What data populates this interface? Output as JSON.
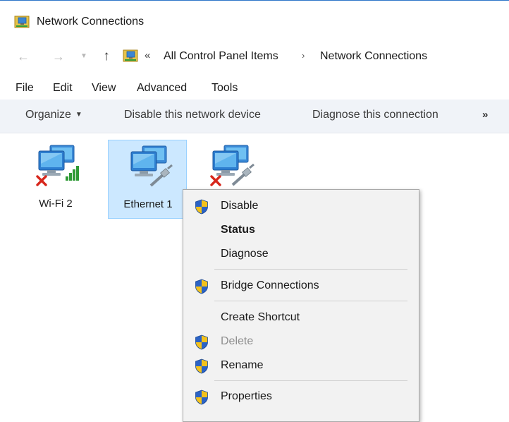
{
  "window": {
    "title": "Network Connections"
  },
  "address": {
    "overflow_chevron": "«",
    "crumbs": [
      "All Control Panel Items",
      "Network Connections"
    ],
    "separator": "›"
  },
  "menubar": [
    "File",
    "Edit",
    "View",
    "Advanced",
    "Tools"
  ],
  "commandbar": {
    "organize": "Organize",
    "disable": "Disable this network device",
    "diagnose": "Diagnose this connection",
    "more": "»"
  },
  "connections": [
    {
      "label": "Wi-Fi 2",
      "status": "disconnected",
      "icon": "wifi-adapter-icon"
    },
    {
      "label": "Ethernet 1",
      "status": "connected",
      "icon": "ethernet-adapter-icon",
      "selected": true
    },
    {
      "label": "",
      "status": "disconnected",
      "icon": "ethernet-adapter-icon"
    }
  ],
  "context_menu": {
    "disable": "Disable",
    "status": "Status",
    "diagnose": "Diagnose",
    "bridge": "Bridge Connections",
    "shortcut": "Create Shortcut",
    "delete": "Delete",
    "rename": "Rename",
    "properties": "Properties"
  },
  "colors": {
    "selection_fill": "#cce8ff",
    "selection_border": "#99d1ff",
    "commandbar_bg": "#f0f3f8",
    "menu_bg": "#f2f2f2",
    "shield_blue": "#2b63c6",
    "shield_yellow": "#f4c21b"
  }
}
